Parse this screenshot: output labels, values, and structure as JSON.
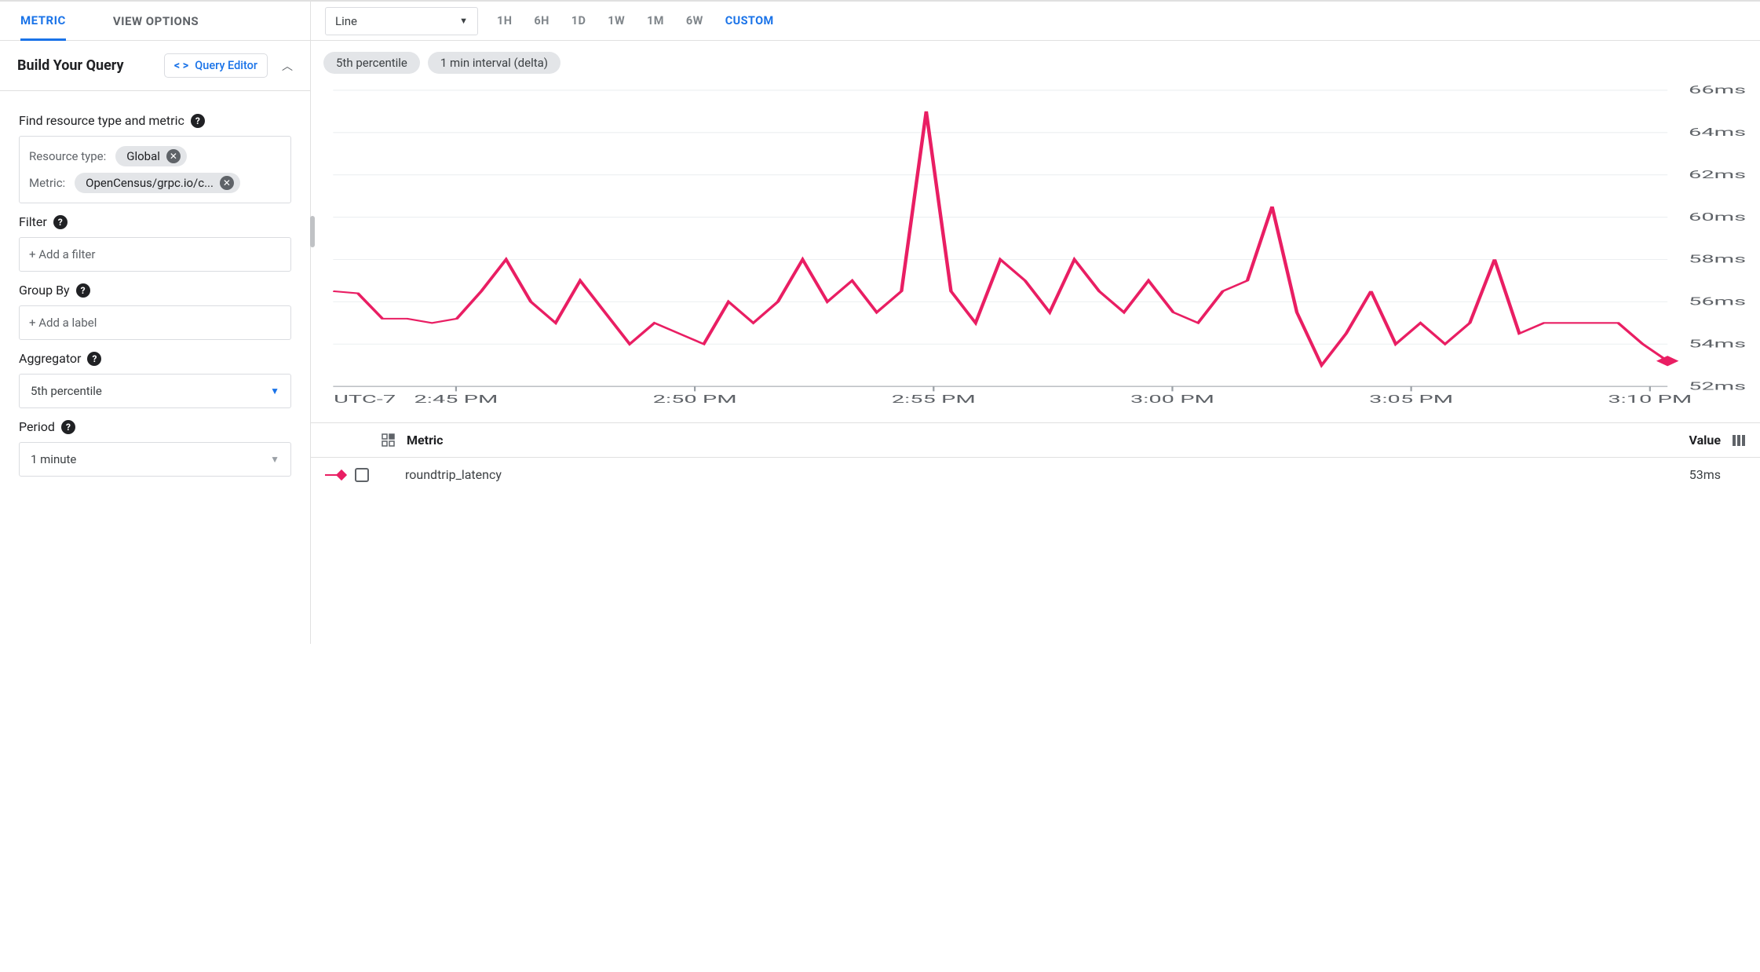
{
  "left": {
    "tabs": {
      "metric": "METRIC",
      "view_options": "VIEW OPTIONS"
    },
    "section_title": "Build Your Query",
    "query_editor_label": "Query Editor",
    "find_label": "Find resource type and metric",
    "resource_type_label": "Resource type:",
    "resource_type_value": "Global",
    "metric_label": "Metric:",
    "metric_value": "OpenCensus/grpc.io/c...",
    "filter_label": "Filter",
    "filter_placeholder": "+ Add a filter",
    "groupby_label": "Group By",
    "groupby_placeholder": "+ Add a label",
    "aggregator_label": "Aggregator",
    "aggregator_value": "5th percentile",
    "period_label": "Period",
    "period_value": "1 minute"
  },
  "right": {
    "chart_type": "Line",
    "ranges": [
      "1H",
      "6H",
      "1D",
      "1W",
      "1M",
      "6W",
      "CUSTOM"
    ],
    "range_active_index": 6,
    "badge1": "5th percentile",
    "badge2": "1 min interval (delta)",
    "timezone": "UTC-7",
    "legend": {
      "metric_header": "Metric",
      "value_header": "Value",
      "series_name": "roundtrip_latency",
      "series_value": "53ms"
    }
  },
  "chart_data": {
    "type": "line",
    "title": "",
    "xlabel": "",
    "ylabel": "",
    "ylim": [
      52,
      66
    ],
    "y_ticks_ms": [
      52,
      54,
      56,
      58,
      60,
      62,
      64,
      66
    ],
    "y_tick_labels": [
      "52ms",
      "54ms",
      "56ms",
      "58ms",
      "60ms",
      "62ms",
      "64ms",
      "66ms"
    ],
    "x_categories": [
      "2:45 PM",
      "2:50 PM",
      "2:55 PM",
      "3:00 PM",
      "3:05 PM",
      "3:10 PM"
    ],
    "timezone_label": "UTC-7",
    "series": [
      {
        "name": "roundtrip_latency",
        "color": "#e91e63",
        "current_value_ms": 53,
        "values_ms": [
          56.5,
          56.4,
          55.2,
          55.2,
          55.0,
          55.2,
          56.5,
          58.0,
          56.0,
          55.0,
          57.0,
          55.5,
          54.0,
          55.0,
          54.5,
          54.0,
          56.0,
          55.0,
          56.0,
          58.0,
          56.0,
          57.0,
          55.5,
          56.5,
          65.0,
          56.5,
          55.0,
          58.0,
          57.0,
          55.5,
          58.0,
          56.5,
          55.5,
          57.0,
          55.5,
          55.0,
          56.5,
          57.0,
          60.5,
          55.5,
          53.0,
          54.5,
          56.5,
          54.0,
          55.0,
          54.0,
          55.0,
          58.0,
          54.5,
          55.0,
          55.0,
          55.0,
          55.0,
          54.0,
          53.2
        ]
      }
    ]
  }
}
